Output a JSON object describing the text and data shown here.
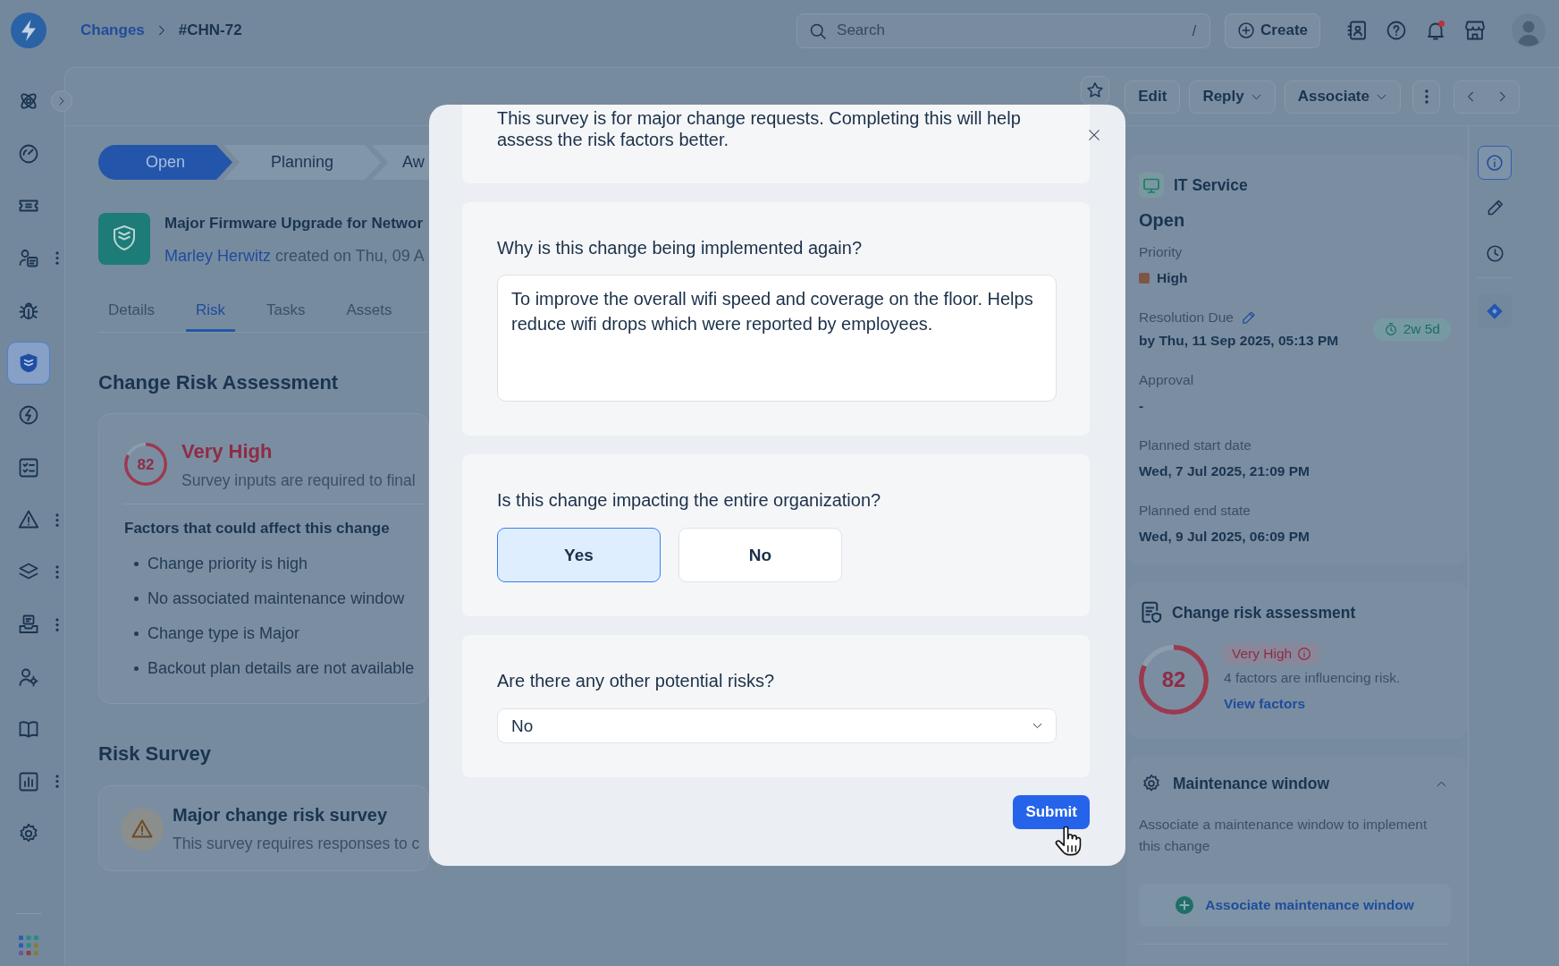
{
  "topbar": {
    "breadcrumb": [
      {
        "label": "Changes",
        "kind": "link"
      },
      {
        "label": "#CHN-72",
        "kind": "current"
      }
    ],
    "search": {
      "placeholder": "Search",
      "shortcut": "/"
    },
    "create_button": "Create",
    "notifications": {
      "unread": true
    }
  },
  "sidebar": {
    "collapsed": true,
    "items": [
      {
        "selected": false,
        "menu": false
      },
      {
        "selected": false,
        "menu": false
      },
      {
        "selected": false,
        "menu": false
      },
      {
        "selected": false,
        "menu": true
      },
      {
        "selected": false,
        "menu": false
      },
      {
        "selected": true,
        "menu": false
      },
      {
        "selected": false,
        "menu": false
      },
      {
        "selected": false,
        "menu": false
      },
      {
        "selected": false,
        "menu": true
      },
      {
        "selected": false,
        "menu": true
      },
      {
        "selected": false,
        "menu": true
      },
      {
        "selected": false,
        "menu": false
      },
      {
        "selected": false,
        "menu": false
      },
      {
        "selected": false,
        "menu": true
      },
      {
        "selected": false,
        "menu": false
      }
    ]
  },
  "toolbar": {
    "starred": false,
    "actions": [
      {
        "label": "Edit",
        "kind": "button"
      },
      {
        "label": "Reply",
        "kind": "menu"
      },
      {
        "label": "Associate",
        "kind": "menu"
      }
    ]
  },
  "record": {
    "stages": [
      {
        "label": "Open",
        "current": true
      },
      {
        "label": "Planning",
        "current": false
      },
      {
        "label": "Aw",
        "current": false
      }
    ],
    "title": "Major Firmware Upgrade for Networ",
    "author": "Marley Herwitz",
    "created": "created on Thu, 09 A",
    "tabs": [
      {
        "label": "Details",
        "selected": false
      },
      {
        "label": "Risk",
        "selected": true
      },
      {
        "label": "Tasks",
        "selected": false
      },
      {
        "label": "Assets",
        "selected": false
      }
    ]
  },
  "risk_assessment": {
    "heading": "Change Risk Assessment",
    "score": "82",
    "level": 0.82,
    "rating": "Very High",
    "note": "Survey inputs are required to final",
    "factors_heading": "Factors that could affect this change",
    "factors": [
      "Change priority is high",
      "No associated maintenance window",
      "Change type is Major",
      "Backout plan details are not available"
    ]
  },
  "risk_survey": {
    "heading": "Risk Survey",
    "title": "Major change risk survey",
    "description": "This survey requires responses to c"
  },
  "details_panel": {
    "service": "IT Service",
    "status": "Open",
    "fields": [
      {
        "kind": "priority",
        "label": "Priority",
        "value": "High",
        "color": "#7d5646"
      },
      {
        "kind": "due",
        "label": "Resolution Due",
        "value": "by Thu, 11 Sep 2025, 05:13 PM",
        "badge": "2w 5d"
      },
      {
        "kind": "text",
        "label": "Approval",
        "value": "-"
      },
      {
        "kind": "text",
        "label": "Planned start date",
        "value": "Wed, 7 Jul 2025, 21:09 PM"
      },
      {
        "kind": "text",
        "label": "Planned end state",
        "value": "Wed, 9 Jul 2025, 06:09 PM"
      }
    ]
  },
  "risk_card": {
    "title": "Change risk assessment",
    "score": "82",
    "level": 0.82,
    "rating": "Very High",
    "summary": "4 factors are influencing risk.",
    "link": "View factors"
  },
  "maintenance": {
    "title": "Maintenance window",
    "expanded": true,
    "description": "Associate a maintenance window to implement this change",
    "button": "Associate maintenance window"
  },
  "right_rail": {
    "tools": [
      {
        "selected": true
      },
      {
        "selected": false
      },
      {
        "selected": false
      }
    ],
    "apps": [
      {
        "selected": false
      }
    ]
  },
  "survey_dialog": {
    "intro": "This survey is for major change requests. Completing this will help assess the risk factors better.",
    "questions": [
      {
        "kind": "text",
        "question": "Why is this change being implemented again?",
        "value": "To improve the overall wifi speed and coverage on the floor. Helps reduce wifi drops which were reported by employees."
      },
      {
        "kind": "choice",
        "question": "Is this change impacting the entire organization?",
        "options": [
          {
            "label": "Yes",
            "selected": true
          },
          {
            "label": "No",
            "selected": false
          }
        ]
      },
      {
        "kind": "dropdown",
        "question": "Are there any other potential risks?",
        "value": "No"
      }
    ],
    "submit": "Submit"
  }
}
